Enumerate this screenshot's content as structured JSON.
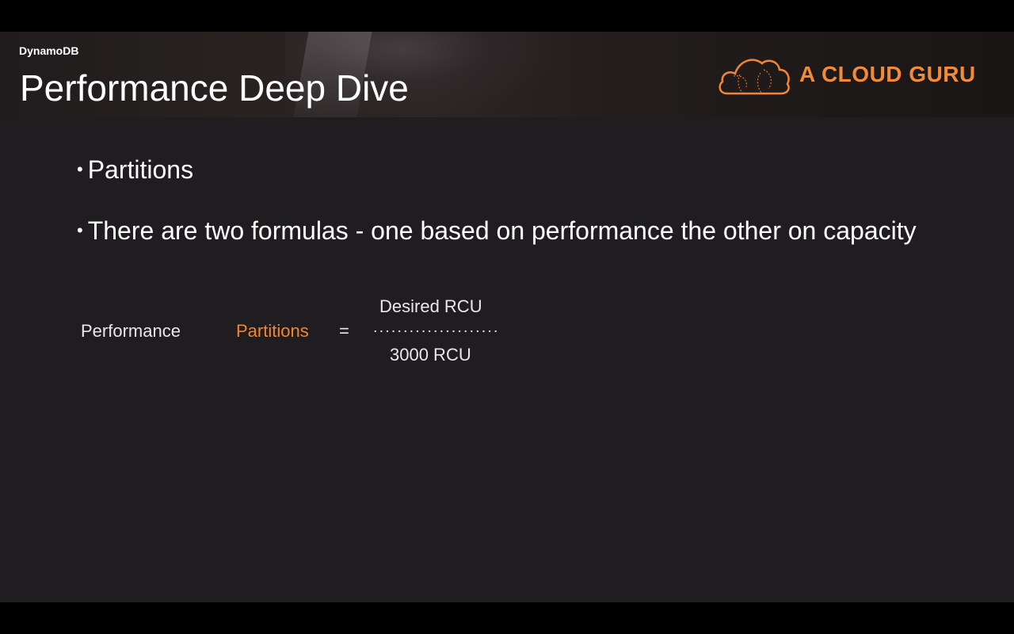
{
  "slide": {
    "section_label": "DynamoDB",
    "title": "Performance Deep Dive",
    "logo_text": "A CLOUD GURU",
    "bullets": [
      "Partitions",
      "There are two formulas - one based on performance the other on capacity"
    ],
    "formula": {
      "label": "Performance",
      "result": "Partitions",
      "equals": "=",
      "numerator": "Desired RCU",
      "denominator": "3000 RCU"
    }
  },
  "colors": {
    "background": "#1f1d20",
    "accent": "#f08535",
    "text": "#ffffff"
  }
}
